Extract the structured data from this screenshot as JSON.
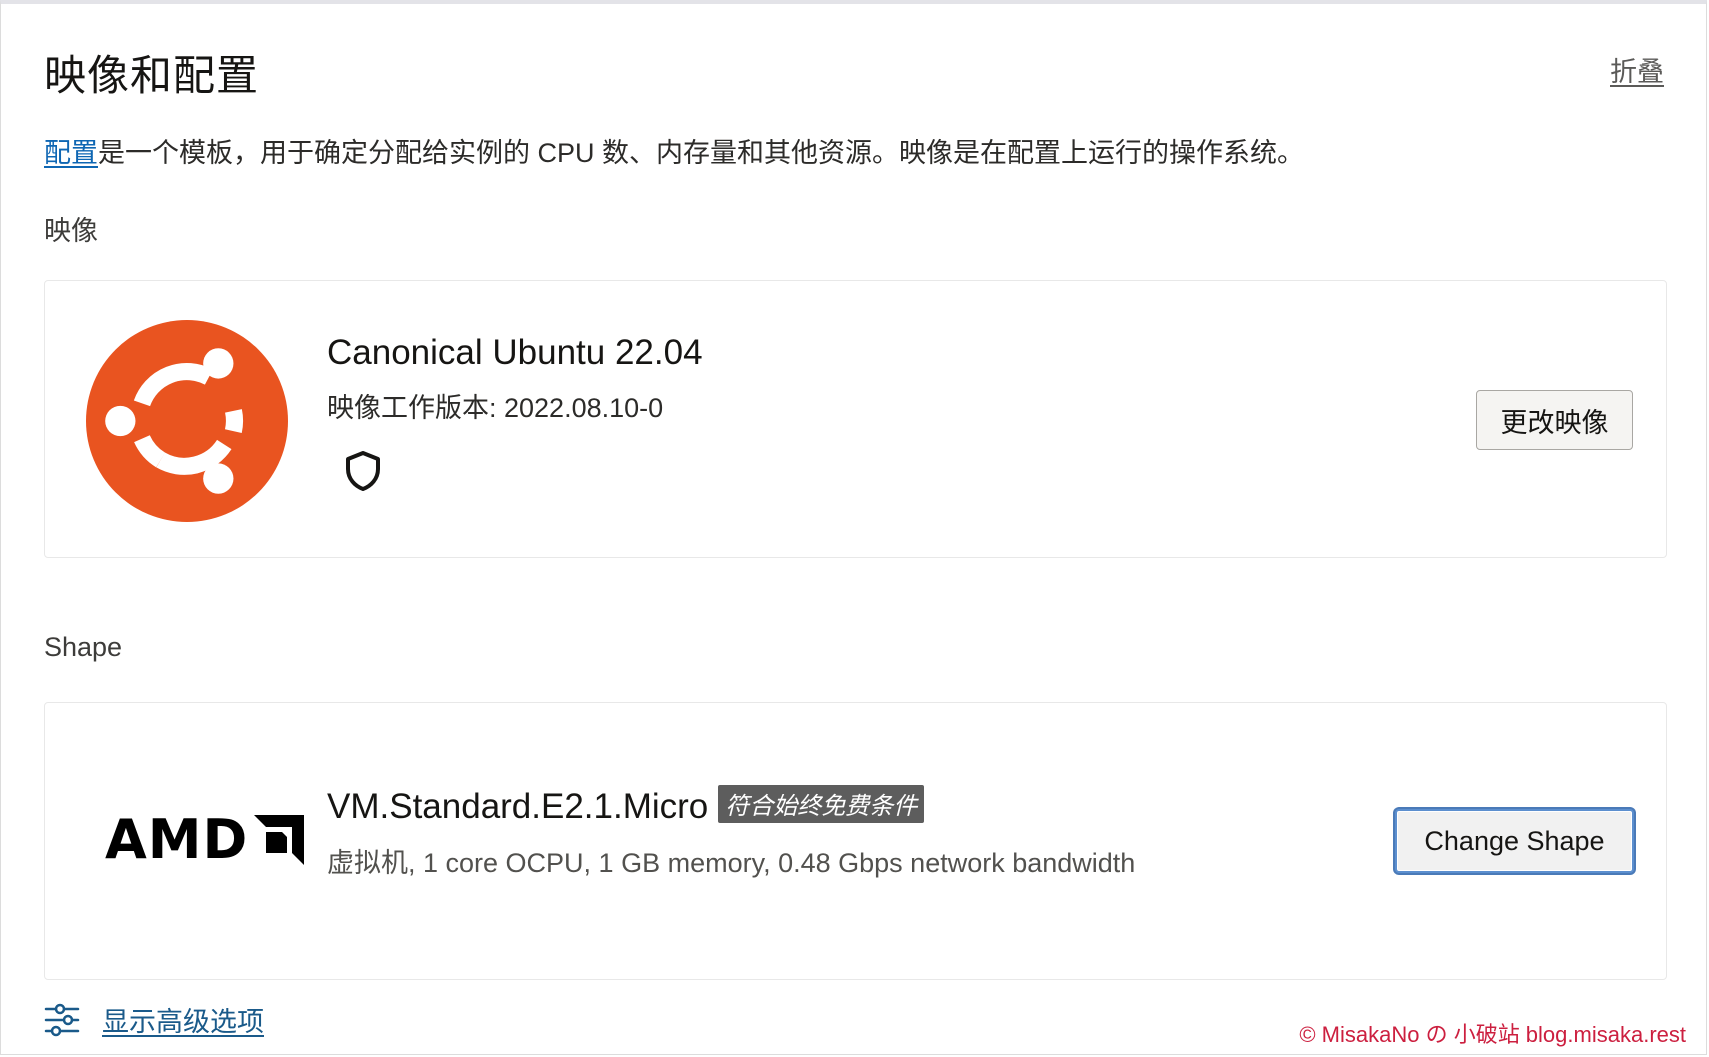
{
  "header": {
    "title": "映像和配置",
    "collapse_label": "折叠"
  },
  "description": {
    "link_text": "配置",
    "rest_text": "是一个模板，用于确定分配给实例的 CPU 数、内存量和其他资源。映像是在配置上运行的操作系统。"
  },
  "image_section": {
    "label": "映像",
    "logo_icon": "ubuntu-logo",
    "logo_color": "#e95420",
    "name": "Canonical Ubuntu 22.04",
    "version_line": "映像工作版本: 2022.08.10-0",
    "shield_icon": "shield-icon",
    "change_button_label": "更改映像"
  },
  "shape_section": {
    "label": "Shape",
    "logo_icon": "amd-logo",
    "logo_text": "AMD",
    "name": "VM.Standard.E2.1.Micro",
    "badge": "符合始终免费条件",
    "details": "虚拟机, 1 core OCPU, 1 GB memory, 0.48 Gbps network bandwidth",
    "change_button_label": "Change Shape"
  },
  "advanced": {
    "icon": "sliders-icon",
    "label": "显示高级选项"
  },
  "watermark": "© MisakaNo の 小破站 blog.misaka.rest"
}
